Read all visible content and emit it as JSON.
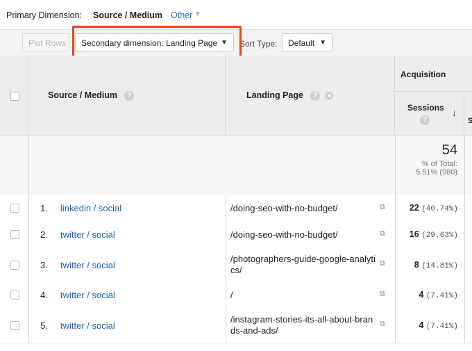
{
  "primary_dimension": {
    "label": "Primary Dimension:",
    "value": "Source / Medium",
    "other": "Other"
  },
  "toolbar": {
    "plot_rows": "Plot Rows",
    "secondary_dimension": "Secondary dimension: Landing Page",
    "sort_type_label": "Sort Type:",
    "sort_type_value": "Default"
  },
  "table": {
    "group_header": "Acquisition",
    "col_source": "Source / Medium",
    "col_landing": "Landing Page",
    "col_sessions": "Sessions",
    "col_partial": "S",
    "totals": {
      "sessions": "54",
      "pct_label": "% of Total:",
      "pct_value": "5.51% (980)"
    },
    "rows": [
      {
        "num": "1.",
        "source": "linkedin / social",
        "landing": "/doing-seo-with-no-budget/",
        "sessions": "22",
        "pct": "(40.74%)"
      },
      {
        "num": "2.",
        "source": "twitter / social",
        "landing": "/doing-seo-with-no-budget/",
        "sessions": "16",
        "pct": "(29.63%)"
      },
      {
        "num": "3.",
        "source": "twitter / social",
        "landing": "/photographers-guide-google-analytics/",
        "sessions": "8",
        "pct": "(14.81%)"
      },
      {
        "num": "4.",
        "source": "twitter / social",
        "landing": "/",
        "sessions": "4",
        "pct": "(7.41%)"
      },
      {
        "num": "5.",
        "source": "twitter / social",
        "landing": "/instagram-stories-its-all-about-brands-and-ads/",
        "sessions": "4",
        "pct": "(7.41%)"
      }
    ]
  },
  "colors": {
    "link": "#1a66b8",
    "highlight": "#f0401f"
  }
}
